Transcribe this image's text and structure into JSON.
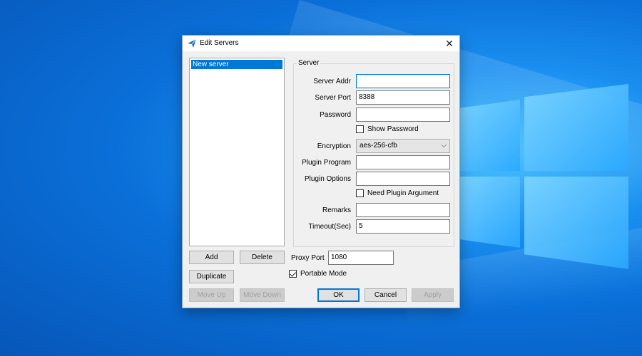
{
  "dialog": {
    "title": "Edit Servers",
    "icon": "paper-plane-icon",
    "close_icon": "close-icon"
  },
  "server_list": {
    "items": [
      "New server"
    ],
    "selected_index": 0
  },
  "server_group": {
    "title": "Server",
    "server_addr_label": "Server Addr",
    "server_addr_value": "",
    "server_port_label": "Server Port",
    "server_port_value": "8388",
    "password_label": "Password",
    "password_value": "",
    "show_password_label": "Show Password",
    "show_password_checked": false,
    "encryption_label": "Encryption",
    "encryption_value": "aes-256-cfb",
    "plugin_program_label": "Plugin Program",
    "plugin_program_value": "",
    "plugin_options_label": "Plugin Options",
    "plugin_options_value": "",
    "need_plugin_argument_label": "Need Plugin Argument",
    "need_plugin_argument_checked": false,
    "remarks_label": "Remarks",
    "remarks_value": "",
    "timeout_label": "Timeout(Sec)",
    "timeout_value": "5"
  },
  "list_buttons": {
    "add": "Add",
    "delete": "Delete",
    "duplicate": "Duplicate",
    "move_up": "Move Up",
    "move_down": "Move Down"
  },
  "proxy": {
    "proxy_port_label": "Proxy Port",
    "proxy_port_value": "1080",
    "portable_mode_label": "Portable Mode",
    "portable_mode_checked": true
  },
  "footer": {
    "ok": "OK",
    "cancel": "Cancel",
    "apply": "Apply"
  },
  "colors": {
    "desktop_blue": "#0a6fd8",
    "selection_blue": "#0078d7",
    "dialog_bg": "#f0f0f0"
  }
}
